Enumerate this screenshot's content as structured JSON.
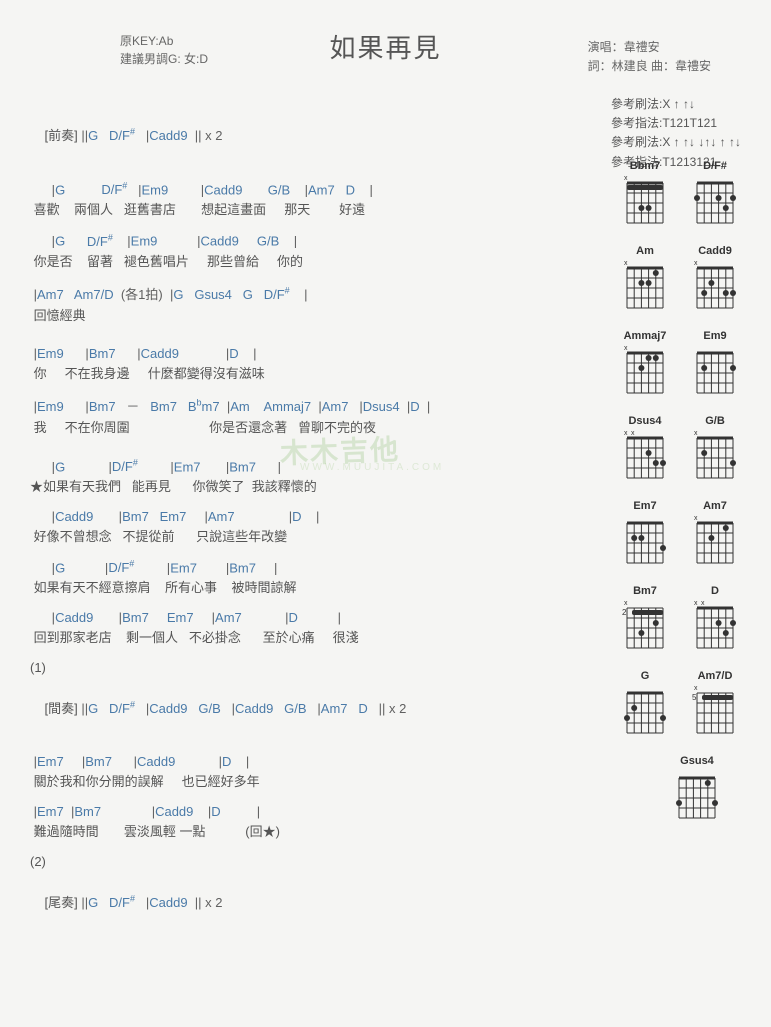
{
  "title": "如果再見",
  "key_info": {
    "line1": "原KEY:Ab",
    "line2": "建議男調G: 女:D"
  },
  "credits": {
    "line1": "演唱：韋禮安",
    "line2": "詞：林建良  曲：韋禮安"
  },
  "patterns": {
    "p1": "參考刷法:X ↑ ↑↓",
    "p2": "參考指法:T121T121",
    "p3": "參考刷法:X ↑ ↑↓ ↓↑↓ ↑ ↑↓",
    "p4": "參考指法:T1213121"
  },
  "sections": {
    "intro": {
      "label": "[前奏]",
      "chords": "|G   D/F#   |Cadd9  || x 2"
    },
    "intro_c": {
      "g": "G",
      "dfs": "D/F",
      "sharp": "#",
      "cadd9": "Cadd9",
      "x2": "|| x 2"
    },
    "outro": {
      "label": "[尾奏]"
    },
    "inter": {
      "label": "[間奏]"
    }
  },
  "verse1": {
    "l1c": {
      "g": "G",
      "dfs": "D/F",
      "sharp": "#",
      "em9": "Em9",
      "cadd9": "Cadd9",
      "gb": "G/B",
      "am7": "Am7",
      "d": "D"
    },
    "l1": " 喜歡    兩個人   逛舊書店       想起這畫面     那天        好遠",
    "l2c": {
      "g": "G",
      "dfs": "D/F",
      "sharp": "#",
      "em9": "Em9",
      "cadd9": "Cadd9",
      "gb": "G/B"
    },
    "l2": " 你是否    留著   褪色舊唱片     那些曾給     你的",
    "l3c": {
      "am7": "Am7",
      "am7d": "Am7/D",
      "note": "(各1拍)",
      "g": "G",
      "gsus4": "Gsus4",
      "g2": "G",
      "dfs": "D/F",
      "sharp": "#"
    },
    "l3": " 回憶經典"
  },
  "prechorus": {
    "l1c": {
      "em9": "Em9",
      "bm7": "Bm7",
      "cadd9": "Cadd9",
      "d": "D"
    },
    "l1": " 你     不在我身邊     什麼都變得沒有滋味",
    "l2c": {
      "em9": "Em9",
      "bm7": "Bm7",
      "dash": "－",
      "bm7b": "Bm7",
      "bbm7": "B",
      "flat": "b",
      "bbm7s": "m7",
      "am": "Am",
      "ammaj7": "Ammaj7",
      "am7": "Am7",
      "dsus4": "Dsus4",
      "d": "D"
    },
    "l2": " 我     不在你周圍                      你是否還念著   曾聊不完的夜"
  },
  "chorus": {
    "l1c": {
      "g": "G",
      "dfs": "D/F",
      "sharp": "#",
      "em7": "Em7",
      "bm7": "Bm7"
    },
    "l1s": "★",
    "l1": "如果有天我們   能再見      你微笑了  我該釋懷的",
    "l2c": {
      "cadd9": "Cadd9",
      "bm7": "Bm7",
      "em7": "Em7",
      "am7": "Am7",
      "d": "D"
    },
    "l2": " 好像不曾想念   不提從前      只說這些年改變",
    "l3c": {
      "g": "G",
      "dfs": "D/F",
      "sharp": "#",
      "em7": "Em7",
      "bm7": "Bm7"
    },
    "l3": " 如果有天不經意擦肩    所有心事    被時間諒解",
    "l4c": {
      "cadd9": "Cadd9",
      "bm7": "Bm7",
      "em7": "Em7",
      "am7": "Am7",
      "d": "D"
    },
    "l4": " 回到那家老店    剩一個人   不必掛念      至於心痛     很淺"
  },
  "num1": "(1)",
  "interlude": {
    "chords_a": "G   D/F",
    "sharp": "#",
    "chords_b": "Cadd9   G/B",
    "chords_c": "Cadd9   G/B",
    "chords_d": "Am7   D",
    "x2": "|| x 2"
  },
  "verse2": {
    "l1c": {
      "em7": "Em7",
      "bm7": "Bm7",
      "cadd9": "Cadd9",
      "d": "D"
    },
    "l1": " 關於我和你分開的誤解     也已經好多年",
    "l2c": {
      "em7": "Em7",
      "bm7": "Bm7",
      "cadd9": "Cadd9",
      "d": "D"
    },
    "l2": " 難過隨時間       雲淡風輕 一點           (回★)"
  },
  "num2": "(2)",
  "diagrams": {
    "r1": {
      "a": "Bbm7",
      "b": "D/F#"
    },
    "r2": {
      "a": "Am",
      "b": "Cadd9"
    },
    "r3": {
      "a": "Ammaj7",
      "b": "Em9"
    },
    "r4": {
      "a": "Dsus4",
      "b": "G/B"
    },
    "r5": {
      "a": "Em7",
      "b": "Am7"
    },
    "r6": {
      "a": "Bm7",
      "b": "D"
    },
    "r7": {
      "a": "G",
      "b": "Am7/D"
    },
    "r8": {
      "a": "Gsus4"
    }
  },
  "watermark": "木木吉他",
  "watermark_sub": "WWW.MUUJITA.COM"
}
